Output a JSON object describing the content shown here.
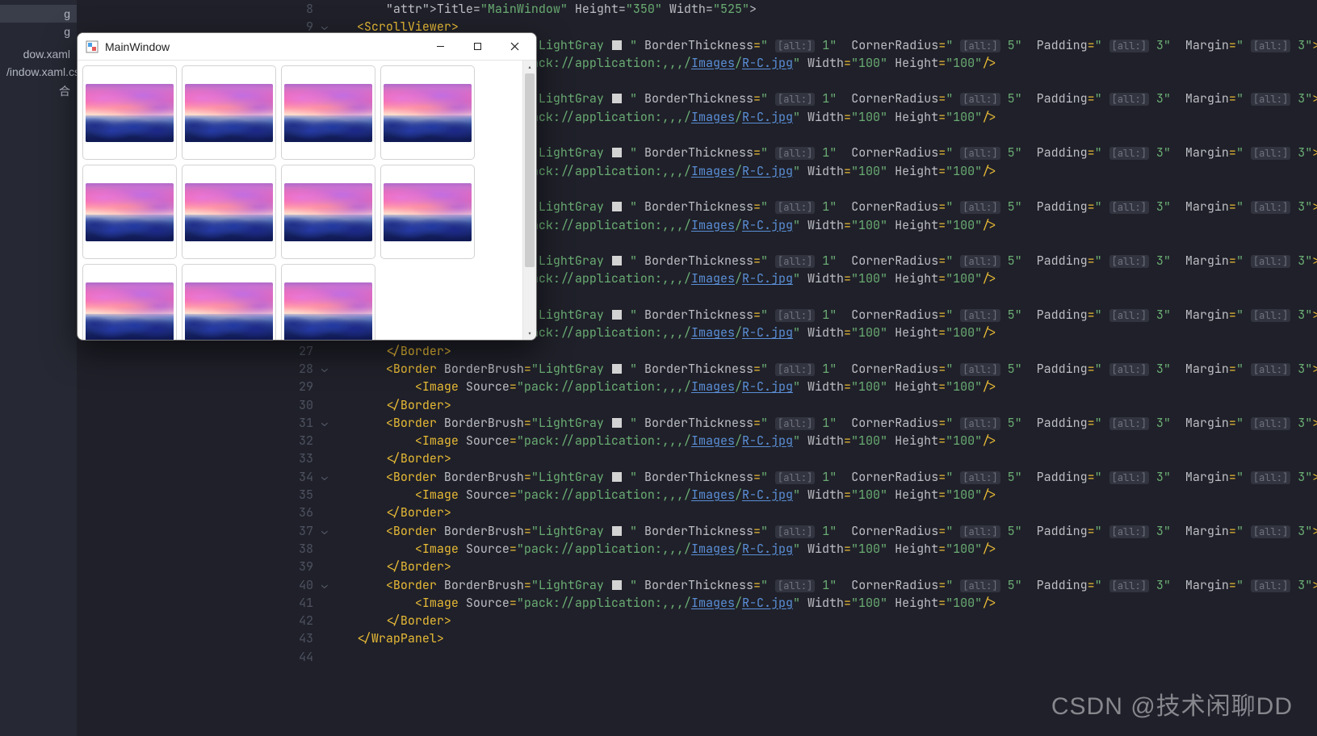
{
  "tree": {
    "items": [
      {
        "label": ""
      },
      {
        "label": "g",
        "sel": true
      },
      {
        "label": "g"
      },
      {
        "label": ""
      },
      {
        "label": "dow.xaml"
      },
      {
        "label": "/indow.xaml.cs"
      },
      {
        "label": "合"
      }
    ]
  },
  "window": {
    "title": "MainWindow",
    "thumb_count": 11
  },
  "editor": {
    "first_line_no": 8,
    "line_count": 37,
    "scrollviewer_open": "ScrollViewer",
    "border_tag": "Border",
    "image_tag": "Image",
    "wrappanel_close": "WrapPanel",
    "attrs": {
      "borderbrush": "BorderBrush",
      "borderbrushv": "LightGray",
      "borderthick": "BorderThickness",
      "borderthickv": "1",
      "corner": "CornerRadius",
      "cornerv": "5",
      "padding": "Padding",
      "paddingv": "3",
      "margin": "Margin",
      "marginv": "3",
      "hint": "[all:]",
      "source": "Source",
      "srcv_prefix": "pack://application:,,,/",
      "srcv_folder": "Images",
      "srcv_file": "R-C.jpg",
      "width": "Width",
      "widthv": "100",
      "height": "Height",
      "heightv": "100",
      "title_line": "Title=\"MainWindow\" Height=\"350\" Width=\"525\">"
    }
  },
  "watermark": "CSDN @技术闲聊DD"
}
